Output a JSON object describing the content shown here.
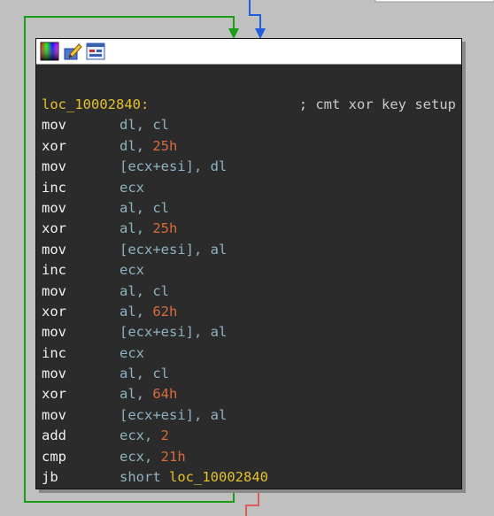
{
  "node": {
    "label": "loc_10002840:",
    "comment": "; cmt xor key setup",
    "lines": [
      {
        "mnemonic": "mov",
        "ops": "dl, cl"
      },
      {
        "mnemonic": "xor",
        "ops": "dl, ",
        "imm": "25h"
      },
      {
        "mnemonic": "mov",
        "ops": "[ecx+esi], dl"
      },
      {
        "mnemonic": "inc",
        "ops": "ecx"
      },
      {
        "mnemonic": "mov",
        "ops": "al, cl"
      },
      {
        "mnemonic": "xor",
        "ops": "al, ",
        "imm": "25h"
      },
      {
        "mnemonic": "mov",
        "ops": "[ecx+esi], al"
      },
      {
        "mnemonic": "inc",
        "ops": "ecx"
      },
      {
        "mnemonic": "mov",
        "ops": "al, cl"
      },
      {
        "mnemonic": "xor",
        "ops": "al, ",
        "imm": "62h"
      },
      {
        "mnemonic": "mov",
        "ops": "[ecx+esi], al"
      },
      {
        "mnemonic": "inc",
        "ops": "ecx"
      },
      {
        "mnemonic": "mov",
        "ops": "al, cl"
      },
      {
        "mnemonic": "xor",
        "ops": "al, ",
        "imm": "64h"
      },
      {
        "mnemonic": "mov",
        "ops": "[ecx+esi], al"
      },
      {
        "mnemonic": "add",
        "ops": "ecx, ",
        "imm": "2"
      },
      {
        "mnemonic": "cmp",
        "ops": "ecx, ",
        "imm": "21h"
      },
      {
        "mnemonic": "jb",
        "ops": "short ",
        "ref": "loc_10002840"
      }
    ]
  },
  "header_icons": [
    "color-palette-icon",
    "edit-node-icon",
    "graph-view-icon"
  ],
  "colors": {
    "background": "#c0c0c0",
    "node_bg": "#2b2b2b",
    "edge_true": "#1a9e1a",
    "edge_incoming": "#1f5fe0",
    "edge_false": "#e05a5a"
  }
}
